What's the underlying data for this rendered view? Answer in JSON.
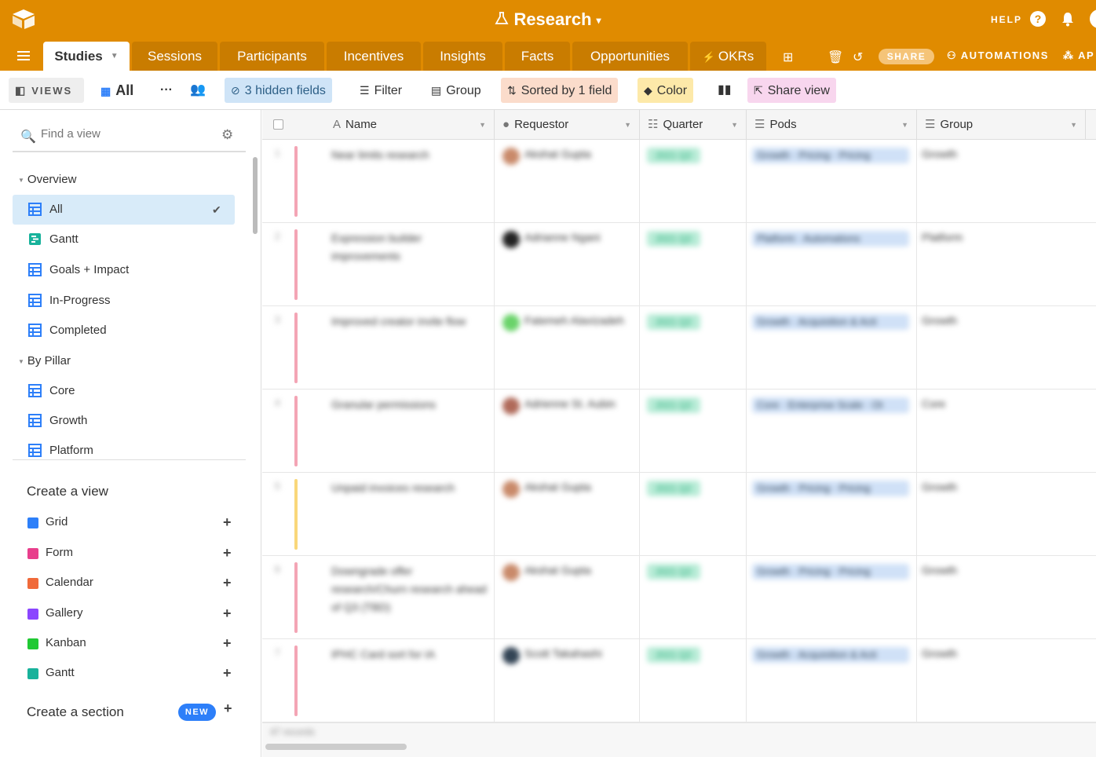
{
  "topbar": {
    "base_title": "Research",
    "help_label": "HELP",
    "help_icon": "?"
  },
  "tabs": [
    {
      "label": "Studies",
      "active": true
    },
    {
      "label": "Sessions"
    },
    {
      "label": "Participants"
    },
    {
      "label": "Incentives"
    },
    {
      "label": "Insights"
    },
    {
      "label": "Facts"
    },
    {
      "label": "Opportunities"
    },
    {
      "label": "OKRs"
    }
  ],
  "tabbar_right": {
    "share_label": "SHARE",
    "automations_label": "AUTOMATIONS",
    "apps_label": "AP"
  },
  "viewbar": {
    "views_label": "VIEWS",
    "current_view": "All",
    "more": "···",
    "hidden_fields": "3 hidden fields",
    "filter": "Filter",
    "group": "Group",
    "sorted": "Sorted by 1 field",
    "color": "Color",
    "share_view": "Share view"
  },
  "sidebar": {
    "find_placeholder": "Find a view",
    "sections": [
      {
        "title": "Overview",
        "items": [
          "All",
          "Gantt",
          "Goals + Impact",
          "In-Progress",
          "Completed"
        ]
      },
      {
        "title": "By Pillar",
        "items": [
          "Core",
          "Growth",
          "Platform"
        ]
      }
    ],
    "create_view_title": "Create a view",
    "create_items": [
      {
        "label": "Grid",
        "color": "#2d7ff9"
      },
      {
        "label": "Form",
        "color": "#e83e8c"
      },
      {
        "label": "Calendar",
        "color": "#f06a3a"
      },
      {
        "label": "Gallery",
        "color": "#8b46ff"
      },
      {
        "label": "Kanban",
        "color": "#20c933"
      },
      {
        "label": "Gantt",
        "color": "#18b29b"
      }
    ],
    "create_section_label": "Create a section",
    "new_badge": "NEW"
  },
  "grid": {
    "columns": [
      "Name",
      "Requestor",
      "Quarter",
      "Pods",
      "Group"
    ],
    "rows": [
      {
        "num": "1",
        "name": "Near limits research",
        "requestor": "Akshat Gupta",
        "quarter": "2021 Q2",
        "pods": "Growth · Pricing · Pricing",
        "group": "Growth",
        "bar": "#f4a5b5",
        "avatar": "#c98a6a"
      },
      {
        "num": "2",
        "name": "Expression builder improvements",
        "requestor": "Adrianne Ngani",
        "quarter": "2021 Q2",
        "pods": "Platform · Automations",
        "group": "Platform",
        "bar": "#f4a5b5",
        "avatar": "#222222"
      },
      {
        "num": "3",
        "name": "Improved creator invite flow",
        "requestor": "Fatemeh Alavizadeh",
        "quarter": "2021 Q2",
        "pods": "Growth · Acquisition & Acti",
        "group": "Growth",
        "bar": "#f4a5b5",
        "avatar": "#6ad36a"
      },
      {
        "num": "4",
        "name": "Granular permissions",
        "requestor": "Adrienne St. Aubin",
        "quarter": "2021 Q2",
        "pods": "Core · Enterprise Scale · Ot",
        "group": "Core",
        "bar": "#f4a5b5",
        "avatar": "#b06a5a"
      },
      {
        "num": "5",
        "name": "Unpaid invoices research",
        "requestor": "Akshat Gupta",
        "quarter": "2021 Q2",
        "pods": "Growth · Pricing · Pricing",
        "group": "Growth",
        "bar": "#f9d77a",
        "avatar": "#c98a6a"
      },
      {
        "num": "6",
        "name": "Downgrade offer research/Churn research ahead of Q3 (TBD)",
        "requestor": "Akshat Gupta",
        "quarter": "2021 Q2",
        "pods": "Growth · Pricing · Pricing",
        "group": "Growth",
        "bar": "#f4a5b5",
        "avatar": "#c98a6a"
      },
      {
        "num": "7",
        "name": "IPHC Card sort for IA",
        "requestor": "Scott Takahashi",
        "quarter": "2021 Q2",
        "pods": "Growth · Acquisition & Acti",
        "group": "Growth",
        "bar": "#f4a5b5",
        "avatar": "#334455"
      }
    ],
    "record_count": "47 records"
  }
}
